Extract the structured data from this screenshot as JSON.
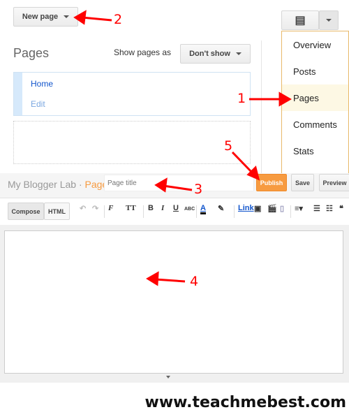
{
  "top": {
    "new_page_label": "New page",
    "pages_title": "Pages",
    "show_pages_as_label": "Show pages as",
    "show_pages_value": "Don't show",
    "page_list": [
      {
        "title": "Home",
        "edit": "Edit"
      }
    ]
  },
  "menu": {
    "items": [
      "Overview",
      "Posts",
      "Pages",
      "Comments",
      "Stats"
    ],
    "selected": "Pages"
  },
  "editor": {
    "blog_name": "My Blogger Lab",
    "separator": "·",
    "crumb": "Page",
    "title_placeholder": "Page title",
    "publish": "Publish",
    "save": "Save",
    "preview": "Preview",
    "compose": "Compose",
    "html": "HTML",
    "toolbar": {
      "bold": "B",
      "italic": "I",
      "underline": "U",
      "strike": "ABC",
      "link": "Link",
      "font": "F",
      "size": "TT",
      "color": "A",
      "quote": "❝"
    }
  },
  "annotations": [
    "1",
    "2",
    "3",
    "4",
    "5"
  ],
  "watermark": "www.teachmebest.com",
  "colors": {
    "accent": "#f79b40",
    "link": "#1155cc",
    "arrow": "#ff0000",
    "menu_border": "#e8b96a"
  }
}
